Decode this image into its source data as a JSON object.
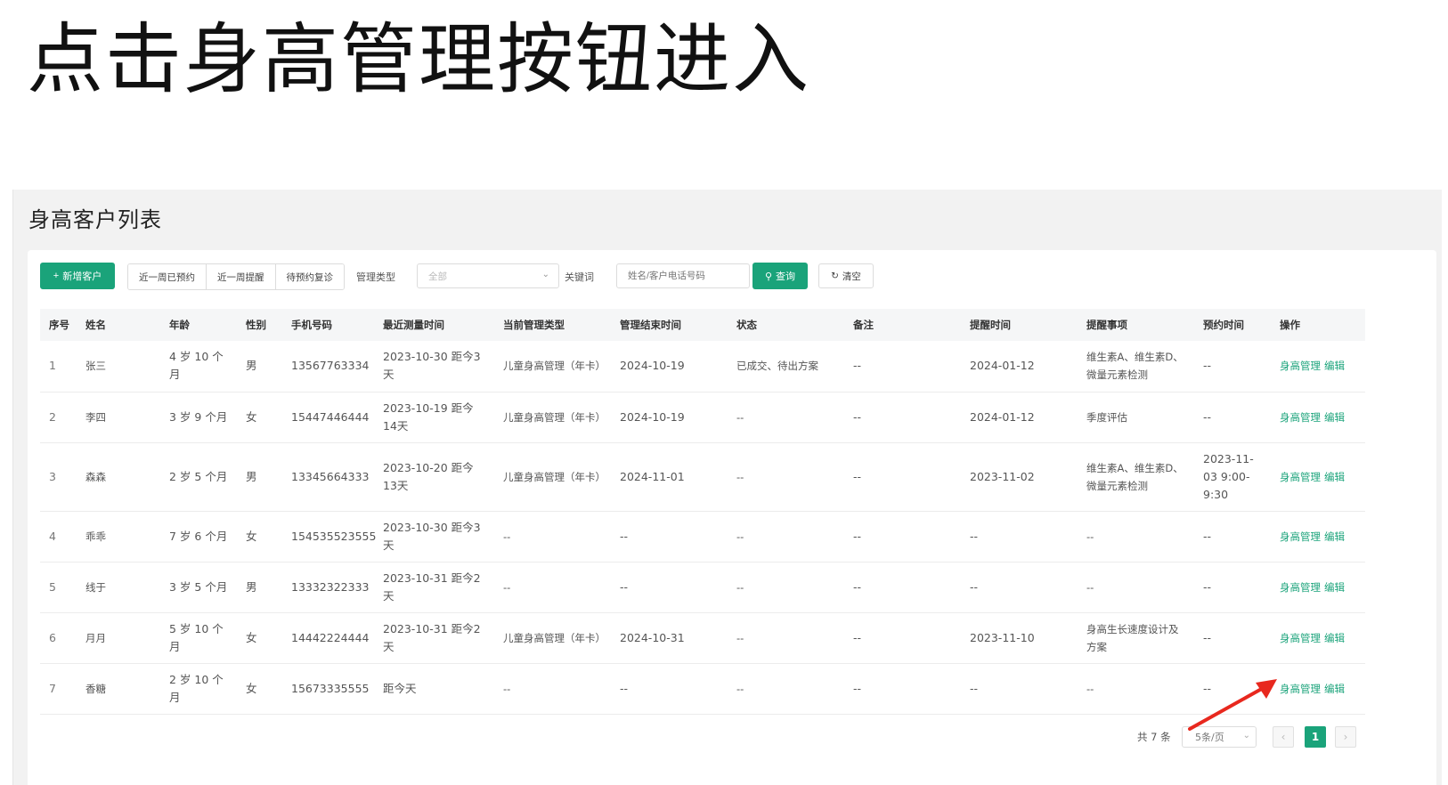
{
  "instruction": "点击身高管理按钮进入",
  "page_title": "身高客户列表",
  "toolbar": {
    "add_label": "新增客户",
    "filters": [
      "近一周已预约",
      "近一周提醒",
      "待预约复诊"
    ],
    "type_label": "管理类型",
    "type_value": "全部",
    "keyword_label": "关键词",
    "keyword_placeholder": "姓名/客户电话号码",
    "search_label": "查询",
    "clear_label": "清空"
  },
  "table": {
    "columns": [
      "序号",
      "姓名",
      "年龄",
      "性别",
      "手机号码",
      "最近测量时间",
      "当前管理类型",
      "管理结束时间",
      "状态",
      "备注",
      "提醒时间",
      "提醒事项",
      "预约时间",
      "操作"
    ],
    "rows": [
      [
        "1",
        "张三",
        "4 岁 10 个月",
        "男",
        "13567763334",
        "2023-10-30 距今3天",
        "儿童身高管理（年卡）",
        "2024-10-19",
        "已成交、待出方案",
        "--",
        "2024-01-12",
        "维生素A、维生素D、微量元素检测",
        "--"
      ],
      [
        "2",
        "李四",
        "3 岁 9 个月",
        "女",
        "15447446444",
        "2023-10-19 距今14天",
        "儿童身高管理（年卡）",
        "2024-10-19",
        "--",
        "--",
        "2024-01-12",
        "季度评估",
        "--"
      ],
      [
        "3",
        "森森",
        "2 岁 5 个月",
        "男",
        "13345664333",
        "2023-10-20 距今13天",
        "儿童身高管理（年卡）",
        "2024-11-01",
        "--",
        "--",
        "2023-11-02",
        "维生素A、维生素D、微量元素检测",
        "2023-11-03 9:00-9:30"
      ],
      [
        "4",
        "乖乖",
        "7 岁 6 个月",
        "女",
        "154535523555",
        "2023-10-30 距今3天",
        "--",
        "--",
        "--",
        "--",
        "--",
        "--",
        "--"
      ],
      [
        "5",
        "线于",
        "3 岁 5 个月",
        "男",
        "13332322333",
        "2023-10-31 距今2天",
        "--",
        "--",
        "--",
        "--",
        "--",
        "--",
        "--"
      ],
      [
        "6",
        "月月",
        "5 岁 10 个月",
        "女",
        "14442224444",
        "2023-10-31 距今2天",
        "儿童身高管理（年卡）",
        "2024-10-31",
        "--",
        "--",
        "2023-11-10",
        "身高生长速度设计及方案",
        "--"
      ],
      [
        "7",
        "香糖",
        "2 岁 10 个月",
        "女",
        "15673335555",
        "距今天",
        "--",
        "--",
        "--",
        "--",
        "--",
        "--",
        "--"
      ]
    ],
    "actions": {
      "height_manage": "身高管理",
      "edit": "编辑"
    }
  },
  "pagination": {
    "total_text": "共 7 条",
    "page_size": "5条/页",
    "prev": "‹",
    "next": "›",
    "current_page": "1"
  },
  "colors": {
    "accent": "#1aa37a",
    "arrow": "#e8281e"
  },
  "icons": {
    "add": "plus-icon",
    "search": "search-icon",
    "clear": "refresh-icon",
    "dropdown": "chevron-down-icon"
  }
}
